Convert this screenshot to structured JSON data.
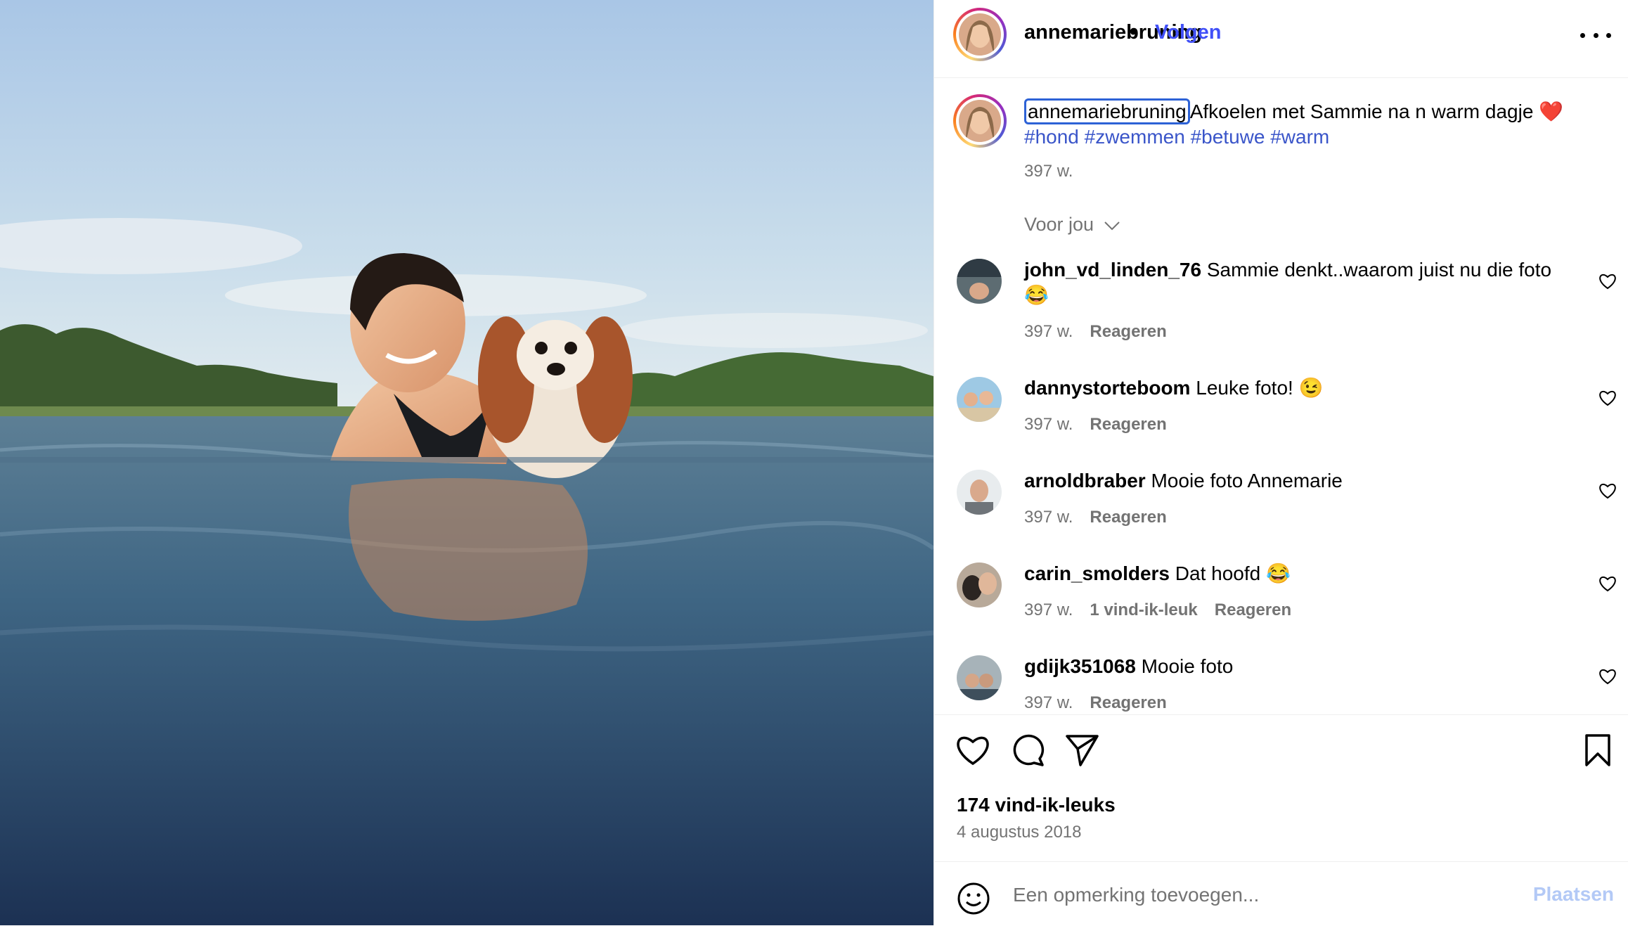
{
  "header": {
    "username": "annemariebruning",
    "separator": "•",
    "follow_label": "Volgen"
  },
  "caption": {
    "username": "annemariebruning",
    "text": "Afkoelen met Sammie na n warm dagje",
    "emoji": "❤️",
    "hashtags": "#hond #zwemmen #betuwe #warm",
    "time": "397 w."
  },
  "sort_label": "Voor jou",
  "comments": [
    {
      "user": "john_vd_linden_76",
      "text": "Sammie denkt..waarom juist nu die foto 😂",
      "time": "397 w.",
      "likes": "",
      "reply": "Reageren"
    },
    {
      "user": "dannystorteboom",
      "text": "Leuke foto! 😉",
      "time": "397 w.",
      "likes": "",
      "reply": "Reageren"
    },
    {
      "user": "arnoldbraber",
      "text": "Mooie foto Annemarie",
      "time": "397 w.",
      "likes": "",
      "reply": "Reageren"
    },
    {
      "user": "carin_smolders",
      "text": "Dat hoofd 😂",
      "time": "397 w.",
      "likes": "1 vind-ik-leuk",
      "reply": "Reageren"
    },
    {
      "user": "gdijk351068",
      "text": "Mooie foto",
      "time": "397 w.",
      "likes": "",
      "reply": "Reageren"
    }
  ],
  "actions": {
    "icons": [
      "heart-icon",
      "comment-icon",
      "share-icon",
      "bookmark-icon"
    ],
    "likes_count": "174 vind-ik-leuks",
    "date": "4 augustus 2018"
  },
  "compose": {
    "placeholder": "Een opmerking toevoegen...",
    "post_label": "Plaatsen"
  },
  "colors": {
    "link": "#3a55c9",
    "follow": "#4150f7",
    "muted": "#737373",
    "post_disabled": "#b3c9f6"
  }
}
